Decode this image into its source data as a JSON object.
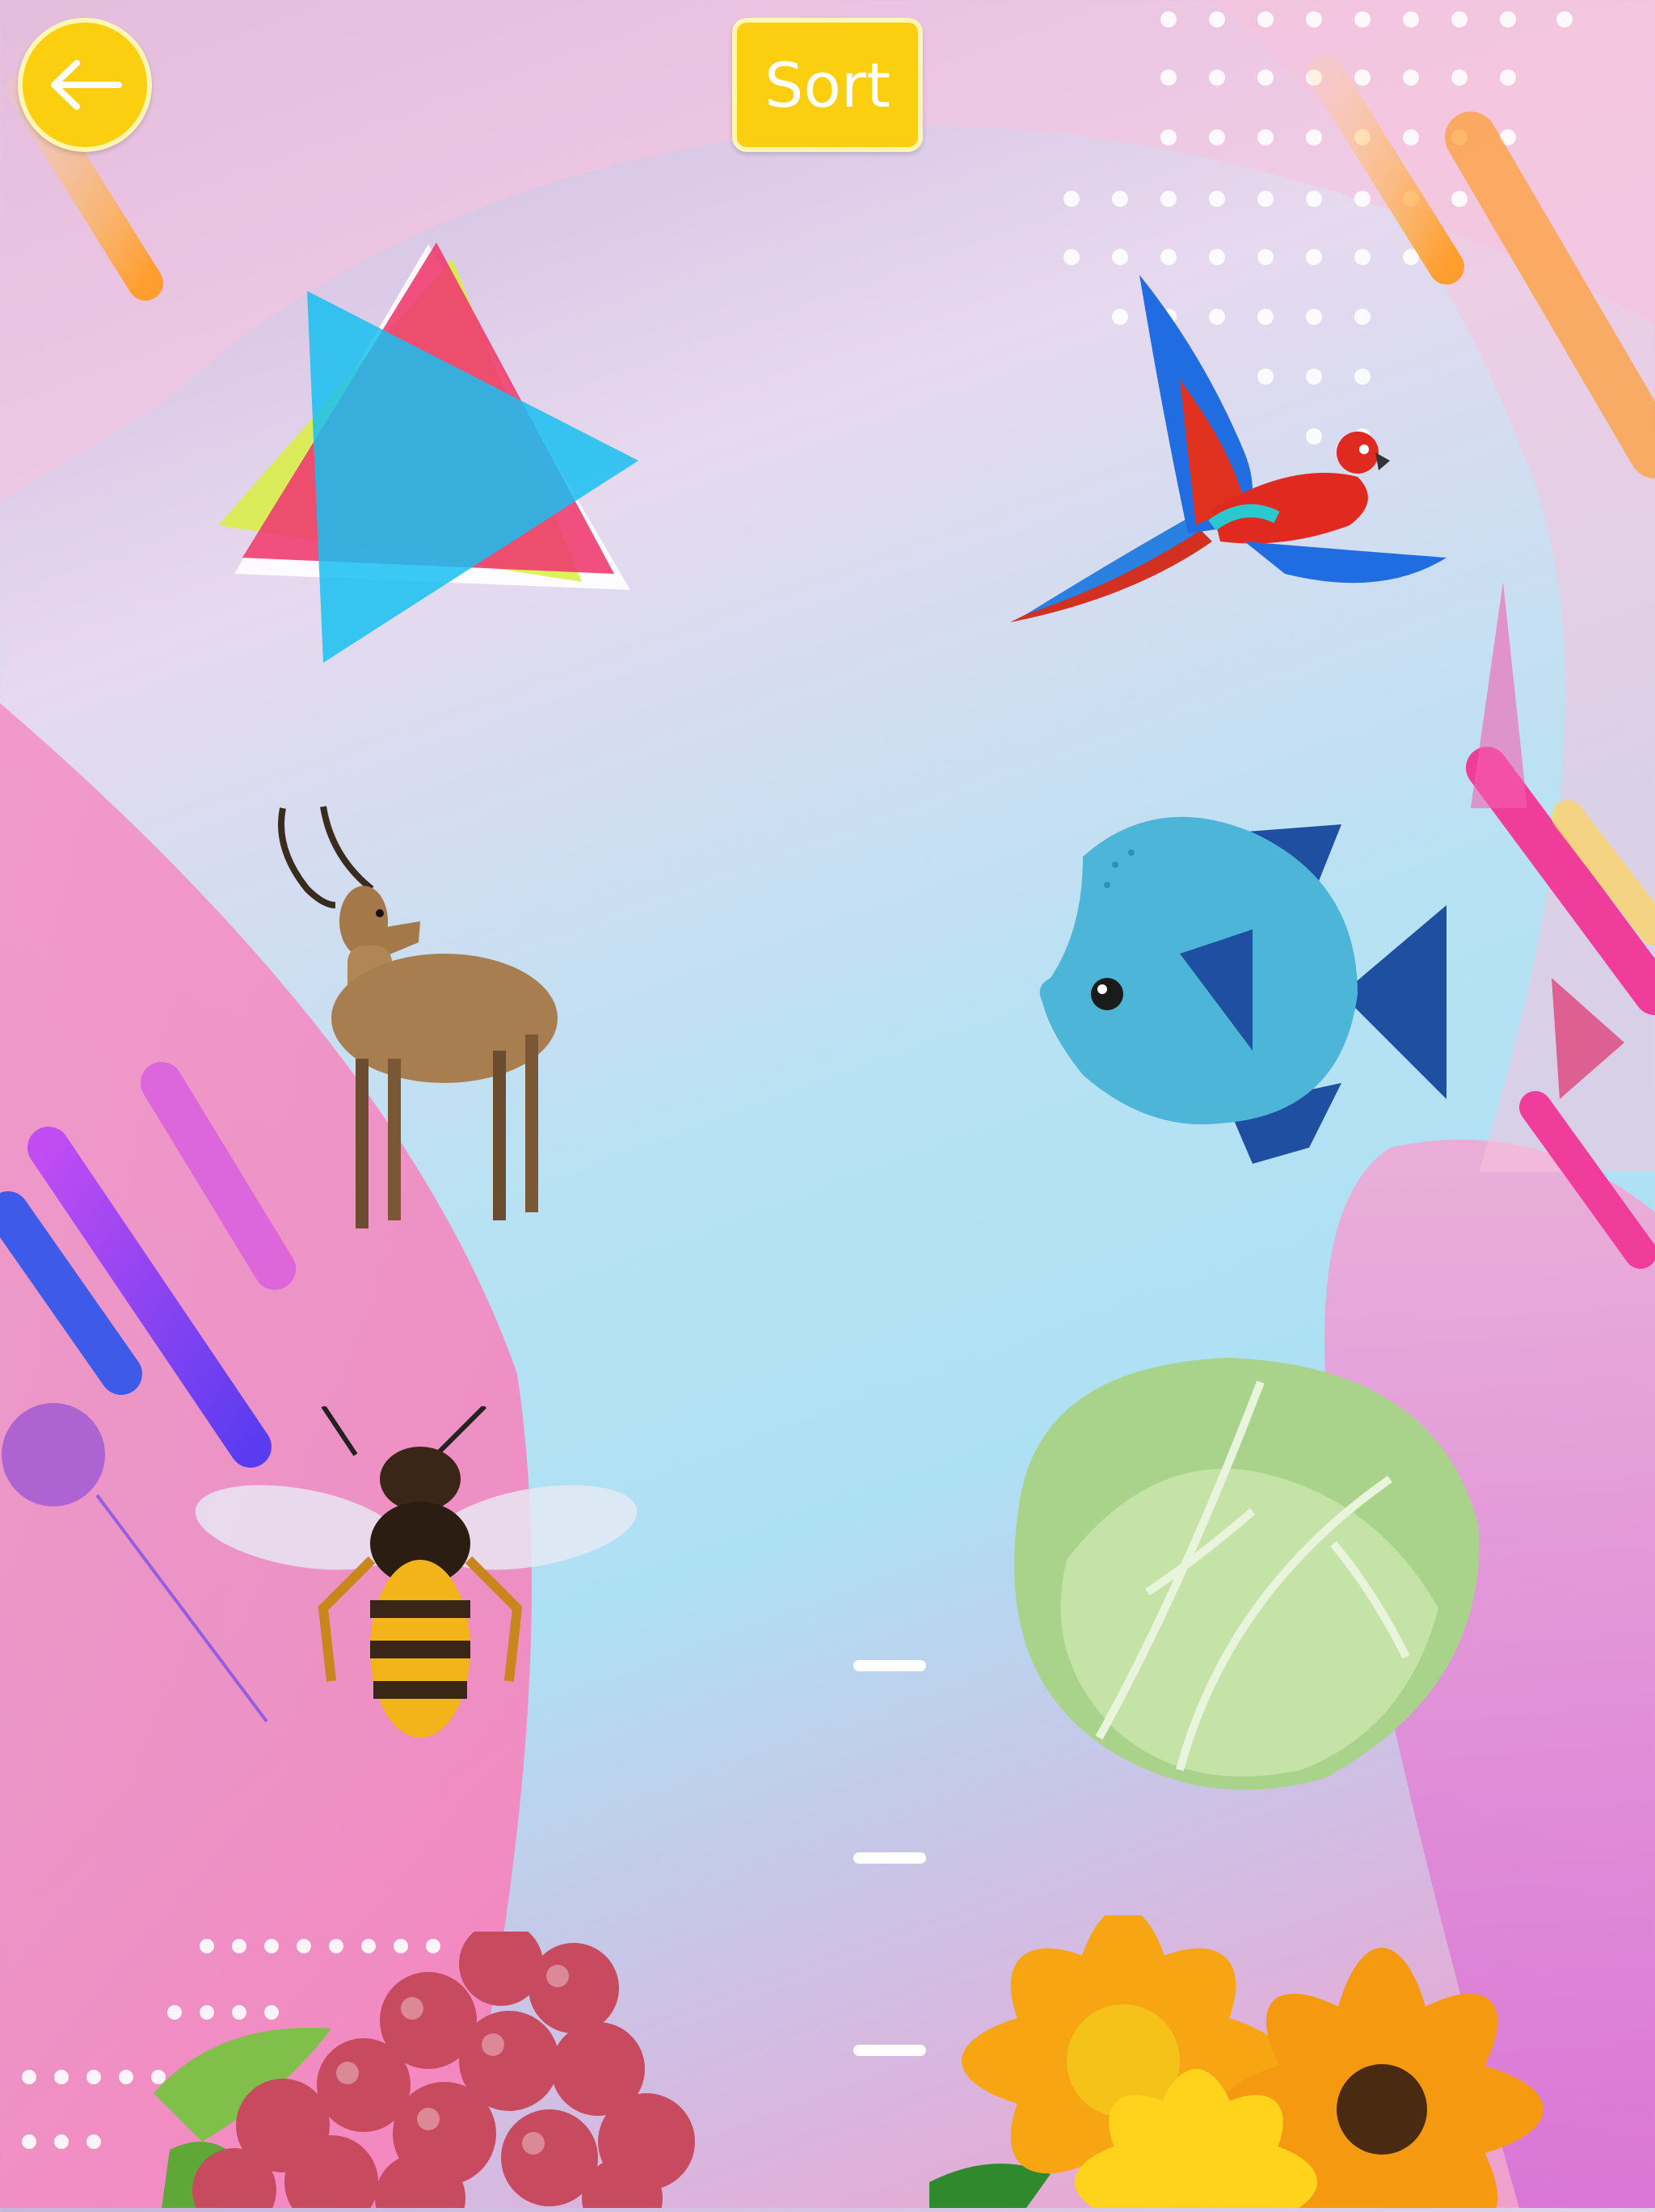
{
  "header": {
    "back_icon": "arrow-left-icon",
    "sort_label": "Sort"
  },
  "colors": {
    "button_fill": "#fbcf10",
    "button_border": "#fff6b3",
    "label_text": "#ffffff"
  },
  "items": [
    {
      "name": "triangles",
      "icon": "triangles-icon"
    },
    {
      "name": "parrot",
      "icon": "parrot-icon"
    },
    {
      "name": "antelope",
      "icon": "antelope-icon"
    },
    {
      "name": "fish",
      "icon": "fish-icon"
    },
    {
      "name": "bee",
      "icon": "bee-icon"
    },
    {
      "name": "cabbage",
      "icon": "cabbage-icon"
    },
    {
      "name": "grapes",
      "icon": "grapes-icon"
    },
    {
      "name": "flower",
      "icon": "flower-icon"
    }
  ]
}
